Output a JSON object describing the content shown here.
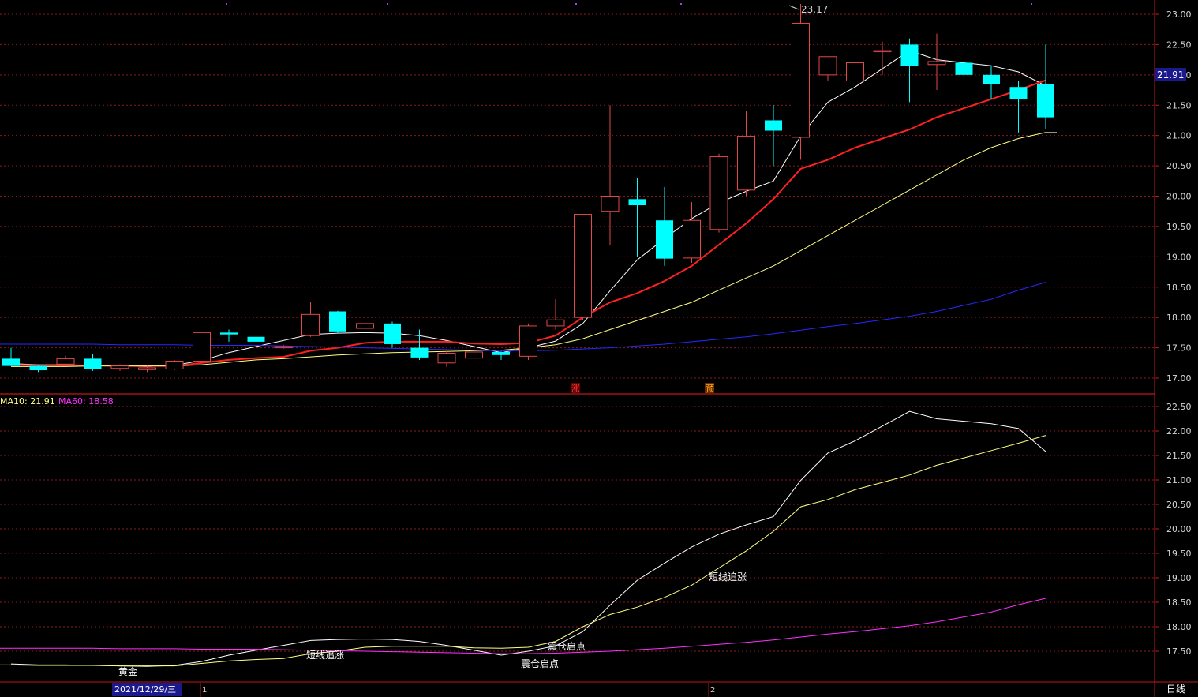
{
  "colors": {
    "background": "#000000",
    "grid": "#8a1a1a",
    "axis_line": "#c01818",
    "axis_text": "#d8d8d8",
    "up_candle": "#e04848",
    "down_candle": "#00ffff",
    "ma5": "#ffffff",
    "ma10_top": "#ff2020",
    "ma20": "#ffff80",
    "ma60_top": "#2828ff",
    "ind_ma10": "#ffff80",
    "ind_ma60": "#ff30ff",
    "ind_short": "#ffffff",
    "label_red": "#ff4040",
    "label_orange": "#ffb020",
    "date_box": "#1a1a8c",
    "price_tag": "#1a1a8c"
  },
  "header": {
    "ma10_label": "MA10: 21.91",
    "ma60_label": "MA60: 18.58"
  },
  "price_tag": "21.91",
  "high_label": "23.17",
  "date_label": "2021/12/29/三",
  "period_label": "日线",
  "month_markers": [
    "1",
    "2"
  ],
  "signal_marks": [
    "涨",
    "预"
  ],
  "annotations": [
    "黄金",
    "短线追涨",
    "震仓启点",
    "震仓启点",
    "短线追涨"
  ],
  "chart_data": [
    {
      "type": "candlestick",
      "title": "",
      "y_axis": {
        "range": [
          16.9,
          23.15
        ],
        "ticks": [
          17.0,
          17.5,
          18.0,
          18.5,
          19.0,
          19.5,
          20.0,
          20.5,
          21.0,
          21.5,
          22.0,
          22.5,
          23.0
        ]
      },
      "ohlc": [
        [
          17.32,
          17.5,
          17.2,
          17.2
        ],
        [
          17.2,
          17.22,
          17.1,
          17.13
        ],
        [
          17.23,
          17.37,
          17.2,
          17.32
        ],
        [
          17.32,
          17.39,
          17.12,
          17.15
        ],
        [
          17.16,
          17.23,
          17.12,
          17.2
        ],
        [
          17.14,
          17.2,
          17.1,
          17.17
        ],
        [
          17.15,
          17.3,
          17.13,
          17.28
        ],
        [
          17.28,
          17.75,
          17.25,
          17.75
        ],
        [
          17.75,
          17.8,
          17.6,
          17.72
        ],
        [
          17.68,
          17.82,
          17.58,
          17.6
        ],
        [
          17.5,
          17.55,
          17.48,
          17.52
        ],
        [
          17.7,
          18.25,
          17.68,
          18.05
        ],
        [
          18.1,
          18.11,
          17.74,
          17.77
        ],
        [
          17.82,
          17.93,
          17.58,
          17.9
        ],
        [
          17.9,
          17.93,
          17.5,
          17.56
        ],
        [
          17.5,
          17.8,
          17.3,
          17.34
        ],
        [
          17.25,
          17.45,
          17.18,
          17.41
        ],
        [
          17.33,
          17.5,
          17.25,
          17.43
        ],
        [
          17.43,
          17.44,
          17.3,
          17.38
        ],
        [
          17.36,
          17.9,
          17.3,
          17.86
        ],
        [
          17.86,
          18.3,
          17.8,
          17.96
        ],
        [
          18.0,
          19.7,
          17.95,
          19.7
        ],
        [
          19.75,
          21.5,
          19.2,
          20.0
        ],
        [
          19.95,
          20.3,
          19.0,
          19.85
        ],
        [
          19.6,
          20.15,
          18.85,
          18.97
        ],
        [
          18.98,
          19.9,
          18.9,
          19.6
        ],
        [
          19.45,
          20.7,
          19.4,
          20.65
        ],
        [
          20.1,
          21.4,
          20.0,
          20.99
        ],
        [
          21.25,
          21.5,
          20.5,
          21.08
        ],
        [
          20.97,
          23.17,
          20.6,
          22.85
        ],
        [
          22.0,
          22.3,
          21.9,
          22.3
        ],
        [
          21.9,
          22.8,
          21.55,
          22.2
        ],
        [
          22.4,
          22.55,
          22.0,
          22.4
        ],
        [
          22.5,
          22.6,
          21.55,
          22.15
        ],
        [
          22.17,
          22.68,
          21.75,
          22.22
        ],
        [
          22.2,
          22.6,
          21.85,
          22.0
        ],
        [
          22.0,
          22.15,
          21.6,
          21.85
        ],
        [
          21.8,
          21.9,
          21.05,
          21.6
        ],
        [
          21.85,
          22.5,
          21.1,
          21.3
        ]
      ],
      "series": [
        {
          "name": "",
          "values": [
            17.24,
            17.22,
            17.22,
            17.21,
            17.2,
            17.19,
            17.21,
            17.29,
            17.42,
            17.52,
            17.62,
            17.72,
            17.74,
            17.75,
            17.74,
            17.7,
            17.62,
            17.52,
            17.42,
            17.5,
            17.61,
            17.9,
            18.44,
            18.95,
            19.3,
            19.63,
            19.89,
            20.08,
            20.25,
            20.99,
            21.55,
            21.8,
            22.1,
            22.4,
            22.25,
            22.2,
            22.15,
            22.05,
            21.82
          ]
        },
        {
          "name": "",
          "values": [
            17.22,
            17.21,
            17.21,
            17.21,
            17.2,
            17.2,
            17.2,
            17.25,
            17.3,
            17.33,
            17.35,
            17.45,
            17.5,
            17.58,
            17.6,
            17.6,
            17.6,
            17.57,
            17.56,
            17.58,
            17.7,
            18.0,
            18.25,
            18.4,
            18.6,
            18.85,
            19.2,
            19.55,
            19.95,
            20.45,
            20.6,
            20.8,
            20.95,
            21.1,
            21.3,
            21.45,
            21.6,
            21.75,
            21.91
          ]
        },
        {
          "name": "",
          "values": [
            17.19,
            17.19,
            17.19,
            17.2,
            17.2,
            17.2,
            17.2,
            17.22,
            17.26,
            17.3,
            17.32,
            17.35,
            17.38,
            17.4,
            17.42,
            17.43,
            17.44,
            17.45,
            17.46,
            17.5,
            17.55,
            17.65,
            17.8,
            17.95,
            18.1,
            18.25,
            18.45,
            18.65,
            18.85,
            19.1,
            19.35,
            19.6,
            19.85,
            20.1,
            20.35,
            20.6,
            20.8,
            20.95,
            21.05
          ]
        },
        {
          "name": "",
          "values": [
            17.56,
            17.56,
            17.56,
            17.56,
            17.55,
            17.55,
            17.55,
            17.54,
            17.54,
            17.54,
            17.53,
            17.52,
            17.51,
            17.5,
            17.49,
            17.48,
            17.47,
            17.46,
            17.45,
            17.45,
            17.46,
            17.48,
            17.5,
            17.53,
            17.56,
            17.6,
            17.64,
            17.68,
            17.73,
            17.79,
            17.85,
            17.9,
            17.96,
            18.02,
            18.1,
            18.2,
            18.3,
            18.45,
            18.58
          ]
        }
      ]
    },
    {
      "type": "line",
      "title": "",
      "y_axis": {
        "range": [
          17.2,
          22.6
        ],
        "ticks": [
          17.5,
          18.0,
          18.5,
          19.0,
          19.5,
          20.0,
          20.5,
          21.0,
          21.5,
          22.0,
          22.5
        ]
      },
      "series": [
        {
          "name": "",
          "values": [
            17.24,
            17.22,
            17.22,
            17.21,
            17.2,
            17.19,
            17.21,
            17.29,
            17.42,
            17.52,
            17.62,
            17.72,
            17.74,
            17.75,
            17.74,
            17.7,
            17.62,
            17.52,
            17.42,
            17.5,
            17.61,
            17.9,
            18.44,
            18.95,
            19.3,
            19.63,
            19.89,
            20.08,
            20.25,
            20.99,
            21.55,
            21.8,
            22.1,
            22.4,
            22.25,
            22.2,
            22.15,
            22.05,
            21.58
          ]
        },
        {
          "name": "MA10",
          "values": [
            17.22,
            17.21,
            17.21,
            17.21,
            17.2,
            17.2,
            17.2,
            17.25,
            17.3,
            17.33,
            17.35,
            17.45,
            17.5,
            17.58,
            17.6,
            17.6,
            17.6,
            17.57,
            17.56,
            17.58,
            17.7,
            18.0,
            18.25,
            18.4,
            18.6,
            18.85,
            19.2,
            19.55,
            19.95,
            20.45,
            20.6,
            20.8,
            20.95,
            21.1,
            21.3,
            21.45,
            21.6,
            21.75,
            21.91
          ]
        },
        {
          "name": "MA60",
          "values": [
            17.56,
            17.56,
            17.56,
            17.56,
            17.55,
            17.55,
            17.55,
            17.54,
            17.54,
            17.54,
            17.53,
            17.52,
            17.51,
            17.5,
            17.49,
            17.48,
            17.47,
            17.46,
            17.45,
            17.45,
            17.46,
            17.48,
            17.5,
            17.53,
            17.56,
            17.6,
            17.64,
            17.68,
            17.73,
            17.79,
            17.85,
            17.9,
            17.96,
            18.02,
            18.1,
            18.2,
            18.3,
            18.45,
            18.58
          ]
        }
      ]
    }
  ]
}
